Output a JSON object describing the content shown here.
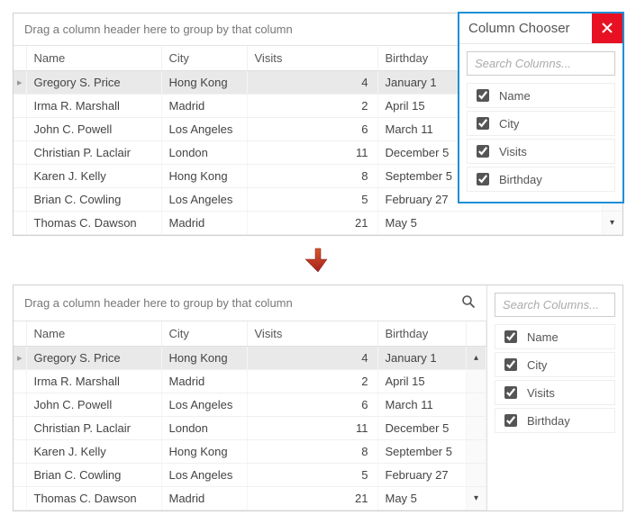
{
  "group_panel_text": "Drag a column header here to group by that column",
  "columns": [
    "Name",
    "City",
    "Visits",
    "Birthday"
  ],
  "rows": [
    {
      "name": "Gregory S. Price",
      "city": "Hong Kong",
      "visits": 4,
      "birthday": "January 1",
      "selected": true
    },
    {
      "name": "Irma R. Marshall",
      "city": "Madrid",
      "visits": 2,
      "birthday": "April 15"
    },
    {
      "name": "John C. Powell",
      "city": "Los Angeles",
      "visits": 6,
      "birthday": "March 11"
    },
    {
      "name": "Christian P. Laclair",
      "city": "London",
      "visits": 11,
      "birthday": "December 5"
    },
    {
      "name": "Karen J. Kelly",
      "city": "Hong Kong",
      "visits": 8,
      "birthday": "September 5"
    },
    {
      "name": "Brian C. Cowling",
      "city": "Los Angeles",
      "visits": 5,
      "birthday": "February 27"
    },
    {
      "name": "Thomas C. Dawson",
      "city": "Madrid",
      "visits": 21,
      "birthday": "May 5"
    }
  ],
  "chooser": {
    "title": "Column Chooser",
    "search_placeholder": "Search Columns...",
    "items": [
      {
        "label": "Name",
        "checked": true
      },
      {
        "label": "City",
        "checked": true
      },
      {
        "label": "Visits",
        "checked": true
      },
      {
        "label": "Birthday",
        "checked": true
      }
    ]
  }
}
